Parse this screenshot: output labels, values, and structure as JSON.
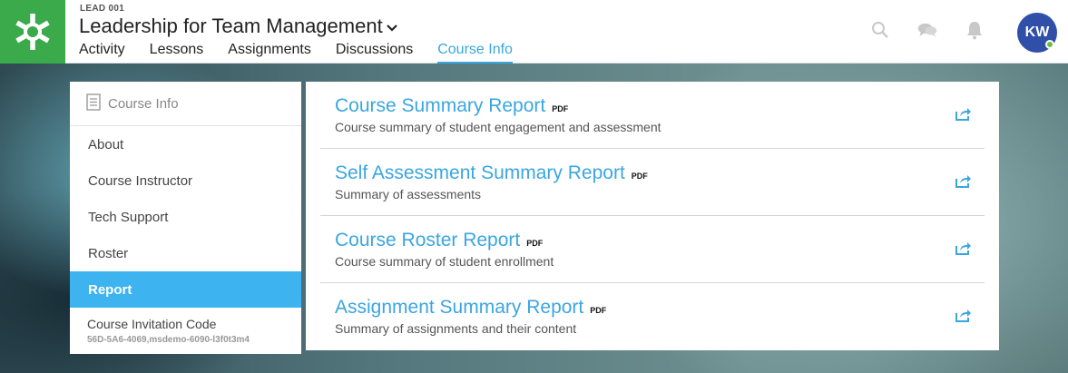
{
  "header": {
    "course_code": "LEAD 001",
    "course_title": "Leadership for Team Management",
    "tabs": [
      {
        "label": "Activity",
        "active": false
      },
      {
        "label": "Lessons",
        "active": false
      },
      {
        "label": "Assignments",
        "active": false
      },
      {
        "label": "Discussions",
        "active": false
      },
      {
        "label": "Course Info",
        "active": true
      }
    ],
    "icons": [
      "search-icon",
      "chat-icon",
      "bell-icon"
    ],
    "avatar_initials": "KW",
    "avatar_color": "#2f4fa8",
    "brand_color": "#3aaa4a"
  },
  "sidebar": {
    "heading": "Course Info",
    "items": [
      {
        "label": "About",
        "active": false
      },
      {
        "label": "Course Instructor",
        "active": false
      },
      {
        "label": "Tech Support",
        "active": false
      },
      {
        "label": "Roster",
        "active": false
      },
      {
        "label": "Report",
        "active": true
      }
    ],
    "invite": {
      "label": "Course Invitation Code",
      "code": "56D-5A6-4069,msdemo-6090-l3f0t3m4"
    }
  },
  "reports": [
    {
      "title": "Course Summary Report",
      "badge": "PDF",
      "description": "Course summary of student engagement and assessment"
    },
    {
      "title": "Self Assessment Summary Report",
      "badge": "PDF",
      "description": "Summary of assessments"
    },
    {
      "title": "Course Roster Report",
      "badge": "PDF",
      "description": "Course summary of student enrollment"
    },
    {
      "title": "Assignment Summary Report",
      "badge": "PDF",
      "description": "Summary of assignments and their content"
    }
  ],
  "colors": {
    "accent": "#3aa6e0",
    "active_sidebar": "#3db4f0"
  }
}
